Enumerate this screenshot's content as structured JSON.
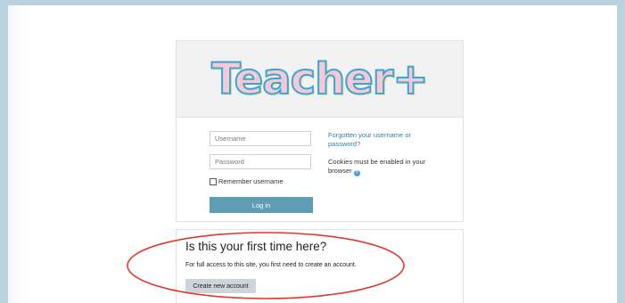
{
  "logo": {
    "text": "Teacher+"
  },
  "login": {
    "username_placeholder": "Username",
    "password_placeholder": "Password",
    "remember_label": "Remember username",
    "login_button": "Log in",
    "forgot_link": "Forgotten your username or password?",
    "cookies_text": "Cookies must be enabled in your browser"
  },
  "signup": {
    "title": "Is this your first time here?",
    "description": "For full access to this site, you first need to create an account.",
    "create_button": "Create new account"
  },
  "colors": {
    "page_background": "#b9d3de",
    "login_button": "#5f9db4",
    "link": "#2f7fa0",
    "annotation_circle": "#e0392b",
    "create_button": "#ced4da"
  },
  "icons": {
    "help": "question-circle-icon"
  }
}
